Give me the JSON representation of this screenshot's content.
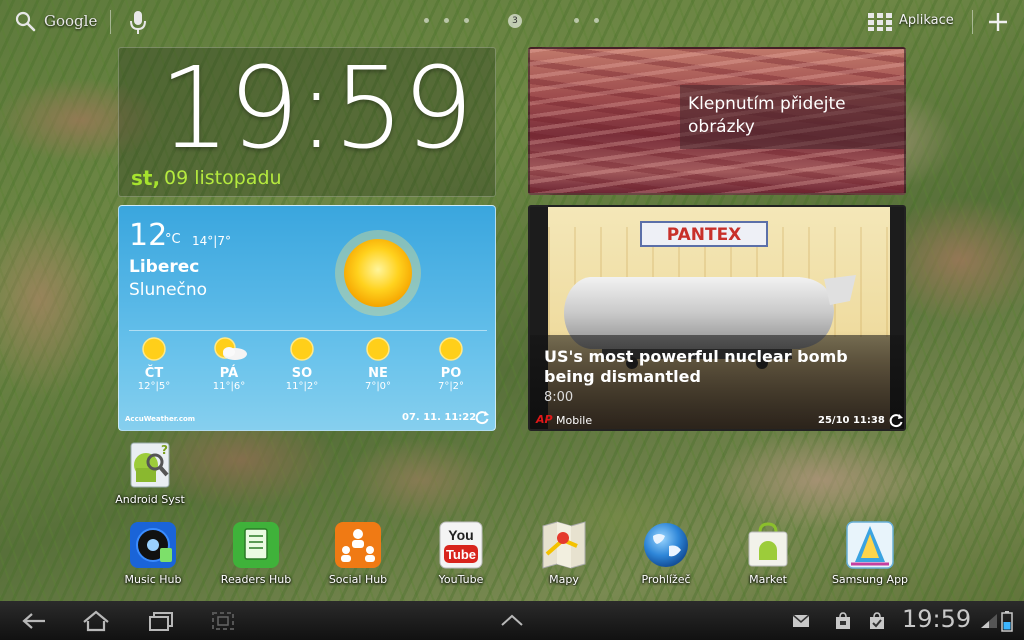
{
  "topbar": {
    "search_label": "Google",
    "apps_label": "Aplikace",
    "current_page": "3",
    "icons": [
      "search-icon",
      "mic-icon",
      "apps-grid-icon",
      "add-icon"
    ]
  },
  "clock": {
    "time": "19:59",
    "day": "st,",
    "date": "09 listopadu"
  },
  "photo_widget": {
    "hint": "Klepnutím přidejte obrázky"
  },
  "weather": {
    "temp": "12",
    "unit": "°C",
    "range": "14°|7°",
    "city": "Liberec",
    "condition": "Slunečno",
    "forecast": [
      {
        "day": "ČT",
        "temps": "12°|5°",
        "icon": "sun-icon"
      },
      {
        "day": "PÁ",
        "temps": "11°|6°",
        "icon": "sun-cloud-icon"
      },
      {
        "day": "SO",
        "temps": "11°|2°",
        "icon": "sun-icon"
      },
      {
        "day": "NE",
        "temps": "7°|0°",
        "icon": "sun-icon"
      },
      {
        "day": "PO",
        "temps": "7°|2°",
        "icon": "sun-icon"
      }
    ],
    "brand": "AccuWeather.com",
    "updated": "07. 11. 11:22"
  },
  "news": {
    "sign": "PANTEX",
    "headline": "US's most powerful nuclear bomb being dismantled",
    "time": "8:00",
    "logo": "AP",
    "source": "Mobile",
    "date": "25/10  11:38"
  },
  "apps": {
    "single": {
      "label": "Android Syst",
      "icon": "android-system-icon"
    },
    "dock": [
      {
        "label": "Music Hub",
        "icon": "music-hub-icon"
      },
      {
        "label": "Readers Hub",
        "icon": "readers-hub-icon"
      },
      {
        "label": "Social Hub",
        "icon": "social-hub-icon"
      },
      {
        "label": "YouTube",
        "icon": "youtube-icon"
      },
      {
        "label": "Mapy",
        "icon": "maps-icon"
      },
      {
        "label": "Prohlížeč",
        "icon": "browser-icon"
      },
      {
        "label": "Market",
        "icon": "market-icon"
      },
      {
        "label": "Samsung App",
        "icon": "samsung-apps-icon"
      }
    ]
  },
  "navbar": {
    "time": "19:59",
    "icons": [
      "back-icon",
      "home-icon",
      "recent-apps-icon",
      "screenshot-icon",
      "up-chevron-icon",
      "mail-icon",
      "bag-icon",
      "check-bag-icon",
      "signal-icon",
      "battery-icon"
    ]
  },
  "colors": {
    "clock_date": "#b5ea3e",
    "weather_sky": "#3aa6de",
    "news_logo": "#e01818",
    "navbar": "#1a1a1a"
  }
}
